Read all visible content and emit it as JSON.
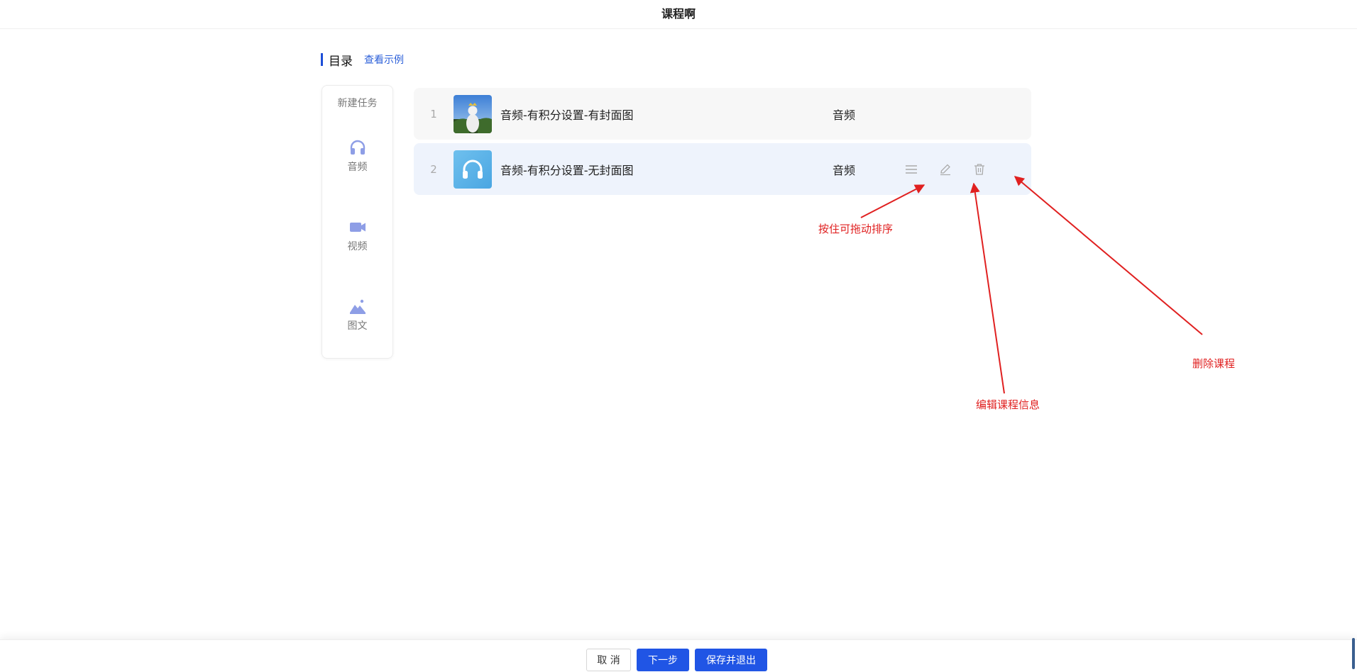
{
  "header": {
    "title": "课程啊"
  },
  "section": {
    "heading": "目录",
    "example_link": "查看示例"
  },
  "task_panel": {
    "title": "新建任务",
    "types": [
      {
        "label": "音频",
        "icon": "headphones-icon"
      },
      {
        "label": "视频",
        "icon": "video-camera-icon"
      },
      {
        "label": "图文",
        "icon": "image-icon"
      }
    ]
  },
  "courses": [
    {
      "index": "1",
      "name": "音频-有积分设置-有封面图",
      "type": "音频",
      "thumb": "cover-photo"
    },
    {
      "index": "2",
      "name": "音频-有积分设置-无封面图",
      "type": "音频",
      "thumb": "headphones-icon"
    }
  ],
  "annotations": {
    "drag": "按住可拖动排序",
    "edit": "编辑课程信息",
    "delete": "删除课程"
  },
  "footer": {
    "cancel": "取 消",
    "next": "下一步",
    "save_exit": "保存并退出"
  },
  "colors": {
    "accent": "#2055e5",
    "annotation": "#e02020",
    "icon": "#8e9ee6"
  }
}
